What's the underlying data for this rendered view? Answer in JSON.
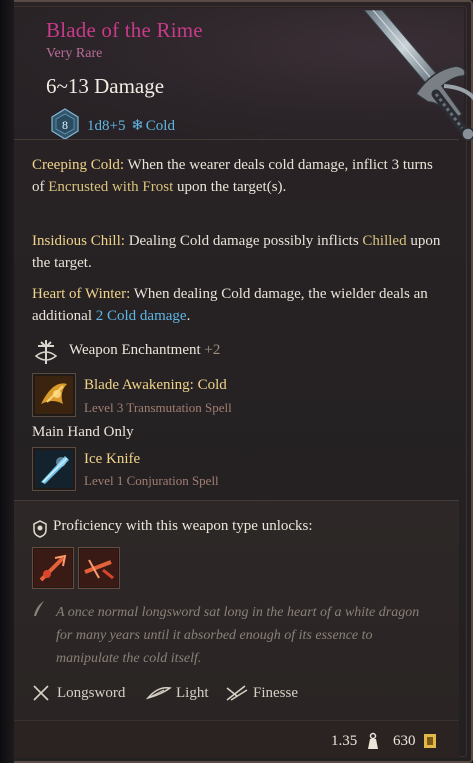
{
  "item": {
    "name": "Blade of the Rime",
    "rarity": "Very Rare",
    "damage": "6~13 Damage",
    "die_value": "8",
    "dice_roll": "1d8+5",
    "damage_type": "Cold"
  },
  "effects": [
    {
      "title": "Creeping Cold:",
      "t1": " When the wearer deals cold damage, inflict 3 turns of ",
      "highlight": "Encrusted with Frost",
      "t2": " upon the target(s)."
    },
    {
      "title": "Insidious Chill:",
      "t1": " Dealing Cold damage possibly inflicts ",
      "highlight": "Chilled",
      "t2": " upon the target."
    },
    {
      "title": "Heart of Winter:",
      "t1": " When dealing Cold damage, the wielder deals an additional ",
      "highlight": "2 Cold damage",
      "t2": "."
    }
  ],
  "enchantment": {
    "label": "Weapon Enchantment",
    "bonus": "+2"
  },
  "spells": [
    {
      "name": "Blade Awakening: Cold",
      "detail": "Level 3 Transmutation Spell"
    },
    {
      "name": "Ice Knife",
      "detail": "Level 1 Conjuration Spell"
    }
  ],
  "main_hand_only": "Main Hand Only",
  "proficiency": "Proficiency with this weapon type unlocks:",
  "flavor_text": "A once normal longsword sat long in the heart of a white dragon for many years until it absorbed enough of its essence to manipulate the cold itself.",
  "properties": [
    {
      "label": "Longsword",
      "icon": "longsword-icon"
    },
    {
      "label": "Light",
      "icon": "feather-icon"
    },
    {
      "label": "Finesse",
      "icon": "finesse-icon"
    }
  ],
  "footer": {
    "weight": "1.35",
    "value": "630"
  },
  "colors": {
    "title": "#c83a8a",
    "rarity": "#b86d9a",
    "keyword": "#f0d489",
    "cold": "#5fb6e3"
  }
}
